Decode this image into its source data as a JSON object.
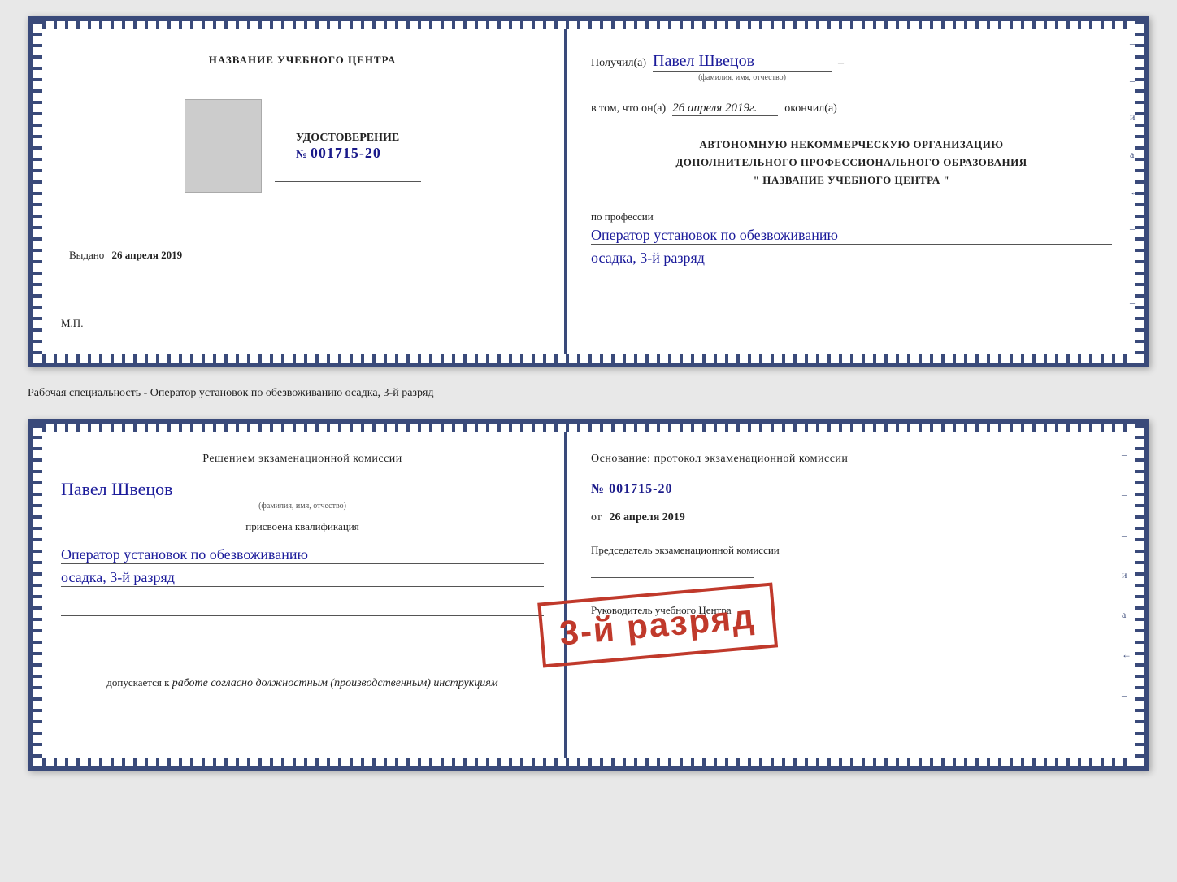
{
  "top_doc": {
    "left": {
      "title": "НАЗВАНИЕ УЧЕБНОГО ЦЕНТРА",
      "cert_label": "УДОСТОВЕРЕНИЕ",
      "cert_number_prefix": "№",
      "cert_number": "001715-20",
      "issued_label": "Выдано",
      "issued_date": "26 апреля 2019",
      "stamp": "М.П."
    },
    "right": {
      "received_label": "Получил(а)",
      "received_name": "Павел Швецов",
      "received_sub": "(фамилия, имя, отчество)",
      "received_dash": "–",
      "in_that_label": "в том, что он(а)",
      "in_that_date": "26 апреля 2019г.",
      "finished_label": "окончил(а)",
      "org_line1": "АВТОНОМНУЮ НЕКОММЕРЧЕСКУЮ ОРГАНИЗАЦИЮ",
      "org_line2": "ДОПОЛНИТЕЛЬНОГО ПРОФЕССИОНАЛЬНОГО ОБРАЗОВАНИЯ",
      "org_line3": "\" НАЗВАНИЕ УЧЕБНОГО ЦЕНТРА \"",
      "profession_label": "по профессии",
      "profession_line1": "Оператор установок по обезвоживанию",
      "profession_line2": "осадка, 3-й разряд"
    }
  },
  "separation_text": "Рабочая специальность - Оператор установок по обезвоживанию осадка, 3-й разряд",
  "bottom_doc": {
    "left": {
      "decision_text": "Решением экзаменационной комиссии",
      "name": "Павел Швецов",
      "name_sub": "(фамилия, имя, отчество)",
      "qualification_label": "присвоена квалификация",
      "qualification_line1": "Оператор установок по обезвоживанию",
      "qualification_line2": "осадка, 3-й разряд",
      "allowed_label": "допускается к",
      "allowed_text": "работе согласно должностным (производственным) инструкциям"
    },
    "right": {
      "basis_text": "Основание: протокол экзаменационной комиссии",
      "number_prefix": "№",
      "number": "001715-20",
      "from_label": "от",
      "from_date": "26 апреля 2019",
      "chairman_label": "Председатель экзаменационной комиссии",
      "director_label": "Руководитель учебного Центра"
    },
    "stamp_text": "3-й разряд"
  }
}
